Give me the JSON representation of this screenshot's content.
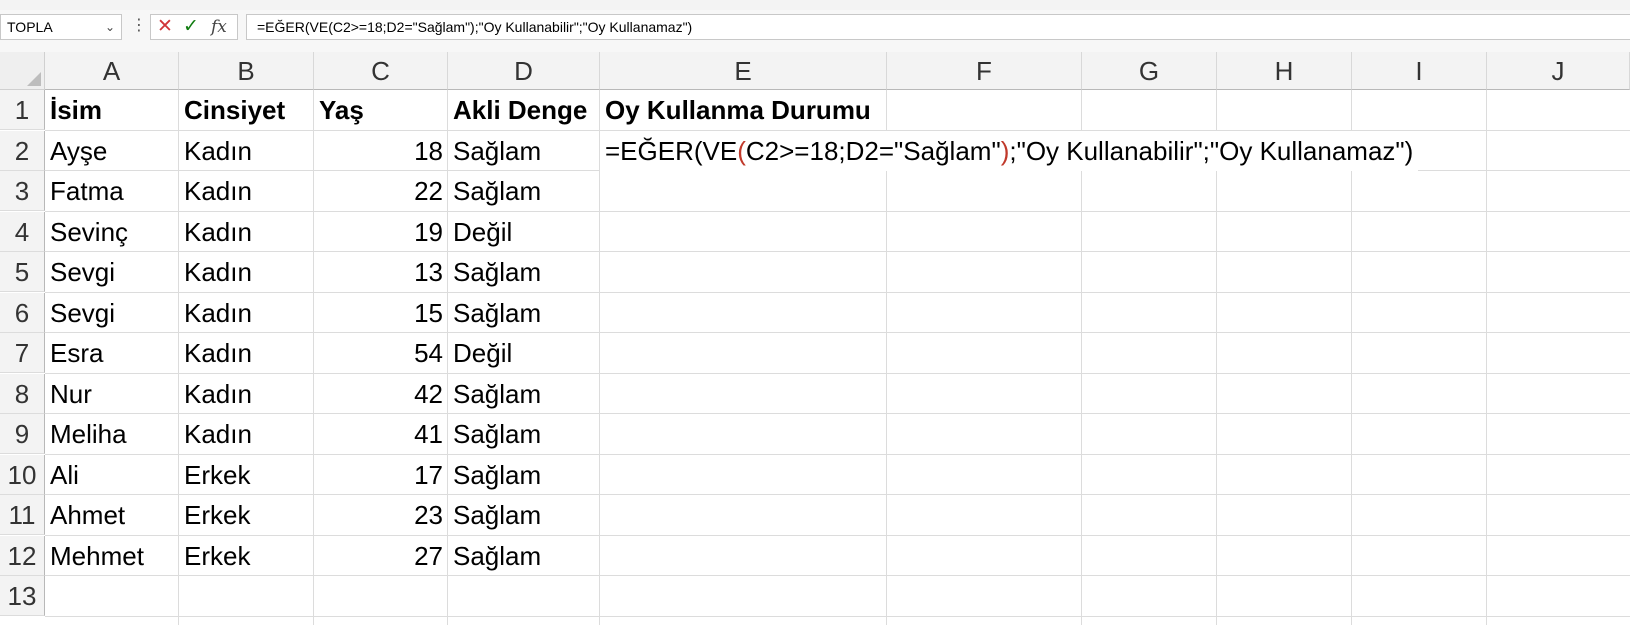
{
  "formula_bar": {
    "name_box": "TOPLA",
    "cancel_icon": "✕",
    "enter_icon": "✓",
    "fx_icon": "fx",
    "formula": "=EĞER(VE(C2>=18;D2=\"Sağlam\");\"Oy Kullanabilir\";\"Oy Kullanamaz\")"
  },
  "columns": [
    "A",
    "B",
    "C",
    "D",
    "E",
    "F",
    "G",
    "H",
    "I",
    "J"
  ],
  "rows": [
    "1",
    "2",
    "3",
    "4",
    "5",
    "6",
    "7",
    "8",
    "9",
    "10",
    "11",
    "12",
    "13"
  ],
  "header_row": {
    "a": "İsim",
    "b": "Cinsiyet",
    "c": "Yaş",
    "d": "Akli Denge",
    "e": "Oy Kullanma Durumu"
  },
  "data_rows": [
    {
      "a": "Ayşe",
      "b": "Kadın",
      "c": "18",
      "d": "Sağlam"
    },
    {
      "a": "Fatma",
      "b": "Kadın",
      "c": "22",
      "d": "Sağlam"
    },
    {
      "a": "Sevinç",
      "b": "Kadın",
      "c": "19",
      "d": "Değil"
    },
    {
      "a": "Sevgi",
      "b": "Kadın",
      "c": "13",
      "d": "Sağlam"
    },
    {
      "a": "Sevgi",
      "b": "Kadın",
      "c": "15",
      "d": "Sağlam"
    },
    {
      "a": "Esra",
      "b": "Kadın",
      "c": "54",
      "d": "Değil"
    },
    {
      "a": "Nur",
      "b": "Kadın",
      "c": "42",
      "d": "Sağlam"
    },
    {
      "a": "Meliha",
      "b": "Kadın",
      "c": "41",
      "d": "Sağlam"
    },
    {
      "a": "Ali",
      "b": "Erkek",
      "c": "17",
      "d": "Sağlam"
    },
    {
      "a": "Ahmet",
      "b": "Erkek",
      "c": "23",
      "d": "Sağlam"
    },
    {
      "a": "Mehmet",
      "b": "Erkek",
      "c": "27",
      "d": "Sağlam"
    }
  ],
  "edit_cell": {
    "part1": "=EĞER(VE",
    "open_paren": "(",
    "part2": "C2>=18;D2=\"Sağlam\"",
    "close_paren": ")",
    "part3": ";\"Oy Kullanabilir\";\"Oy Kullanamaz\")"
  }
}
